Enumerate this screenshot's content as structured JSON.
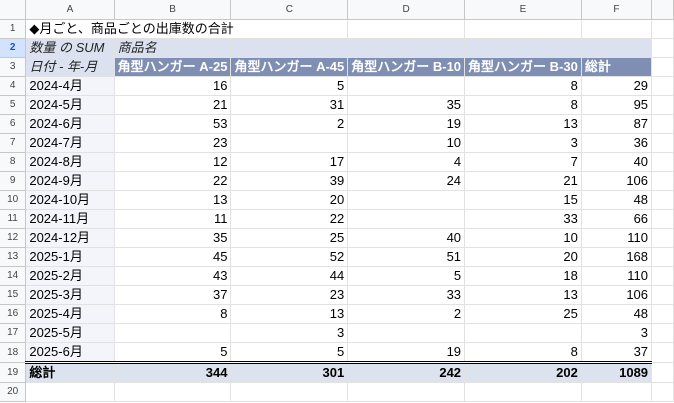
{
  "columns": [
    "A",
    "B",
    "C",
    "D",
    "E",
    "F"
  ],
  "title": "◆月ごと、商品ごとの出庫数の合計",
  "pivot": {
    "value_label": "数量 の SUM",
    "column_field_label": "商品名",
    "row_field_label": "日付 - 年-月",
    "headers": [
      "角型ハンガー A-25",
      "角型ハンガー A-45",
      "角型ハンガー B-10",
      "角型ハンガー B-30",
      "総計"
    ],
    "rows": [
      {
        "label": "2024-4月",
        "values": [
          "16",
          "5",
          "",
          "8",
          "29"
        ]
      },
      {
        "label": "2024-5月",
        "values": [
          "21",
          "31",
          "35",
          "8",
          "95"
        ]
      },
      {
        "label": "2024-6月",
        "values": [
          "53",
          "2",
          "19",
          "13",
          "87"
        ]
      },
      {
        "label": "2024-7月",
        "values": [
          "23",
          "",
          "10",
          "3",
          "36"
        ]
      },
      {
        "label": "2024-8月",
        "values": [
          "12",
          "17",
          "4",
          "7",
          "40"
        ]
      },
      {
        "label": "2024-9月",
        "values": [
          "22",
          "39",
          "24",
          "21",
          "106"
        ]
      },
      {
        "label": "2024-10月",
        "values": [
          "13",
          "20",
          "",
          "15",
          "48"
        ]
      },
      {
        "label": "2024-11月",
        "values": [
          "11",
          "22",
          "",
          "33",
          "66"
        ]
      },
      {
        "label": "2024-12月",
        "values": [
          "35",
          "25",
          "40",
          "10",
          "110"
        ]
      },
      {
        "label": "2025-1月",
        "values": [
          "45",
          "52",
          "51",
          "20",
          "168"
        ]
      },
      {
        "label": "2025-2月",
        "values": [
          "43",
          "44",
          "5",
          "18",
          "110"
        ]
      },
      {
        "label": "2025-3月",
        "values": [
          "37",
          "23",
          "33",
          "13",
          "106"
        ]
      },
      {
        "label": "2025-4月",
        "values": [
          "8",
          "13",
          "2",
          "25",
          "48"
        ]
      },
      {
        "label": "2025-5月",
        "values": [
          "",
          "3",
          "",
          "",
          "3"
        ]
      },
      {
        "label": "2025-6月",
        "values": [
          "5",
          "5",
          "19",
          "8",
          "37"
        ]
      }
    ],
    "total": {
      "label": "総計",
      "values": [
        "344",
        "301",
        "242",
        "202",
        "1089"
      ]
    }
  },
  "row_numbers": [
    "1",
    "2",
    "3",
    "4",
    "5",
    "6",
    "7",
    "8",
    "9",
    "10",
    "11",
    "12",
    "13",
    "14",
    "15",
    "16",
    "17",
    "18",
    "19",
    "20"
  ],
  "selected_row": "2"
}
